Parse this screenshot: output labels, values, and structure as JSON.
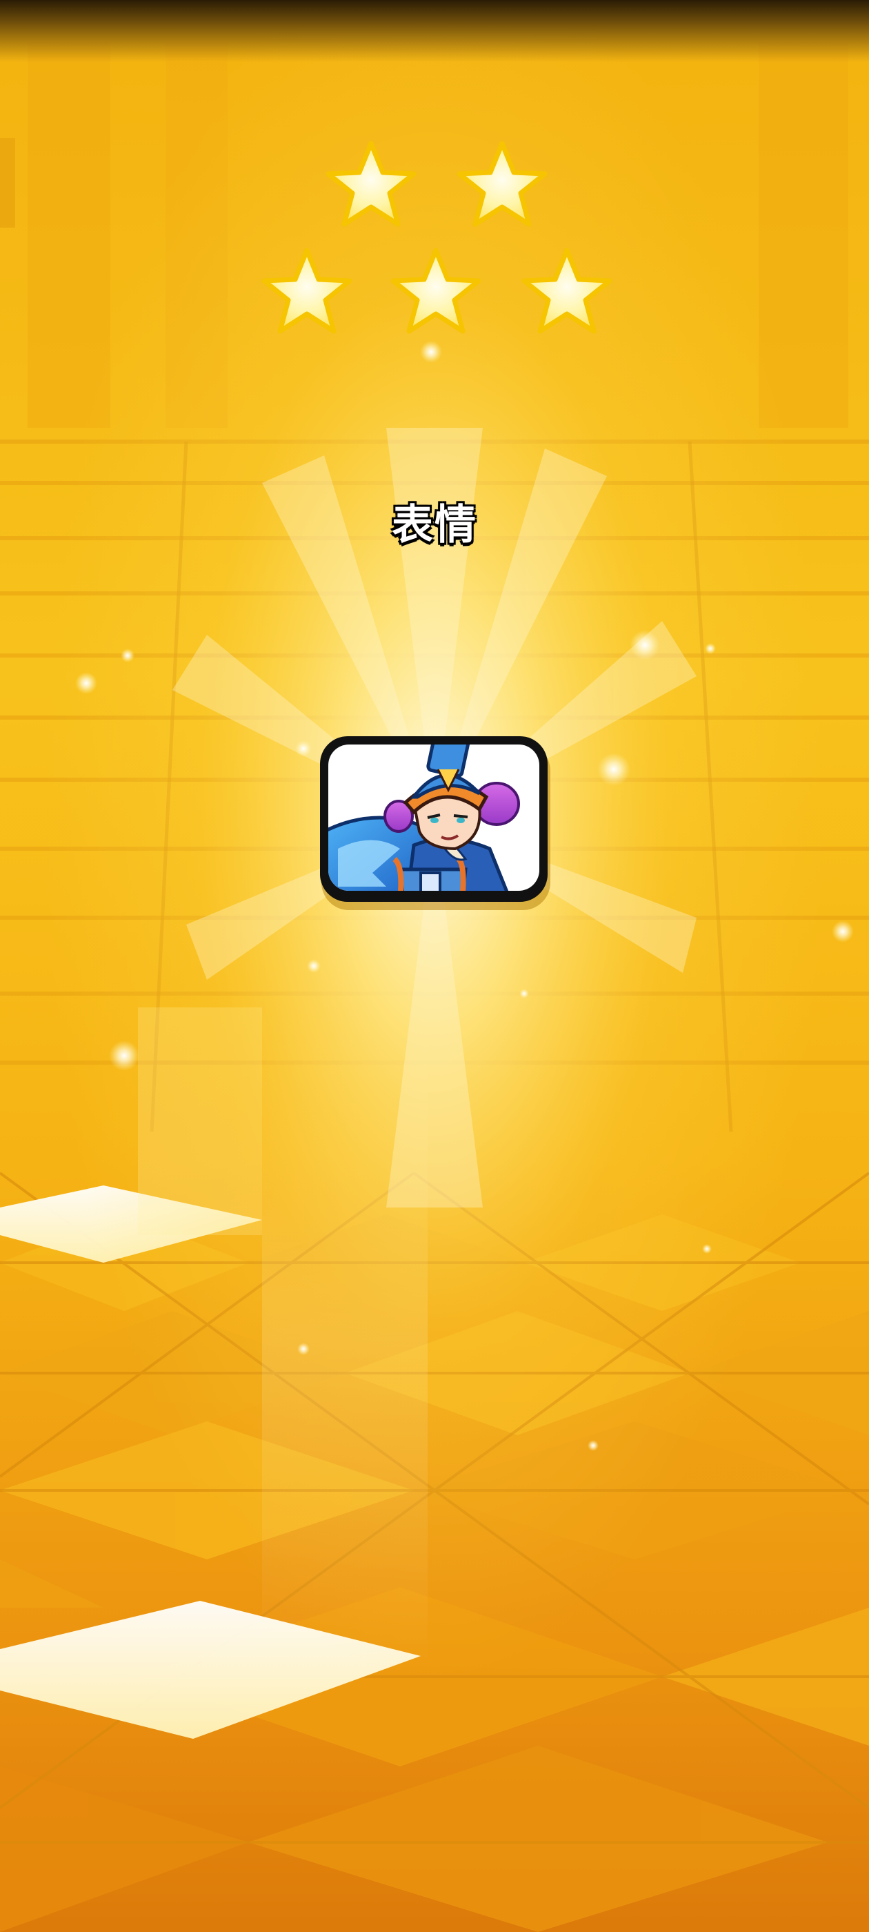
{
  "reward": {
    "title": "表情",
    "item_icon": "knight-girl-emote-icon",
    "star_rating": 5,
    "star_max": 5
  },
  "colors": {
    "background_gold": "#f6b510",
    "glow": "#fff6c8",
    "star_fill": "#fff8b0",
    "star_edge": "#f5c800",
    "card_border": "#111111"
  }
}
